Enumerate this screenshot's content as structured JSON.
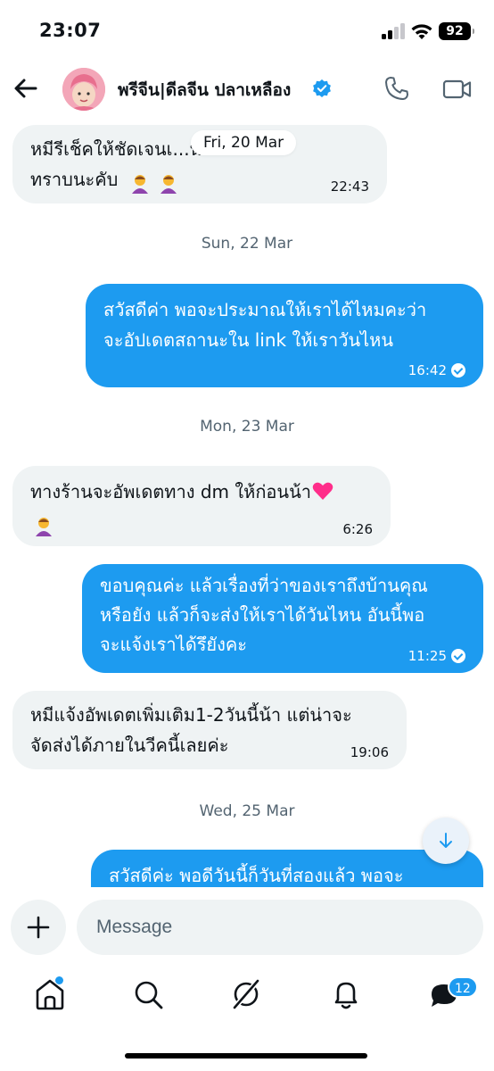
{
  "status_bar": {
    "time": "23:07",
    "battery": "92"
  },
  "header": {
    "contact_name": "พรีจีน|ดีลจีน ปลาเหลือง"
  },
  "floating_date": "Fri, 20 Mar",
  "messages": [
    {
      "direction": "in",
      "text": "หมีรีเช็คให้ชัดเจนเ...น่ชัดให้\nทราบนะคับ",
      "time": "22:43"
    },
    {
      "direction": "separator",
      "text": "Sun, 22 Mar"
    },
    {
      "direction": "out",
      "text": "สวัสดีค่า พอจะประมาณให้เราได้ไหมคะว่า\nจะอัปเดตสถานะใน link ให้เราวันไหน",
      "time": "16:42"
    },
    {
      "direction": "separator",
      "text": "Mon, 23 Mar"
    },
    {
      "direction": "in",
      "text": "ทางร้านจะอัพเดตทาง dm ให้ก่อนน้า",
      "time": "6:26"
    },
    {
      "direction": "out",
      "text": "ขอบคุณค่ะ แล้วเรื่องที่ว่าของเราถึงบ้านคุณ\nหรือยัง แล้วก็จะส่งให้เราได้วันไหน อันนี้พอ\nจะแจ้งเราได้รึยังคะ",
      "time": "11:25"
    },
    {
      "direction": "in",
      "text": "หมีแจ้งอัพเดตเพิ่มเติม1-2วันนี้น้า แต่น่าจะ\nจัดส่งได้ภายในวีคนี้เลยค่ะ",
      "time": "19:06"
    },
    {
      "direction": "separator",
      "text": "Wed, 25 Mar"
    },
    {
      "direction": "out",
      "text": "สวัสดีค่ะ พอดีวันนี้ก็วันที่สองแล้ว พอจะ",
      "time": ""
    }
  ],
  "composer": {
    "placeholder": "Message"
  },
  "tab_bar": {
    "messages_badge": "12"
  },
  "colors": {
    "accent": "#1d9bf0",
    "incoming_bubble": "#eff3f4",
    "separator_text": "#536471"
  },
  "icons": [
    "back-arrow-icon",
    "verified-badge-icon",
    "phone-icon",
    "video-icon",
    "plus-icon",
    "home-icon",
    "search-icon",
    "grok-icon",
    "bell-icon",
    "messages-icon",
    "arrow-down-icon"
  ]
}
